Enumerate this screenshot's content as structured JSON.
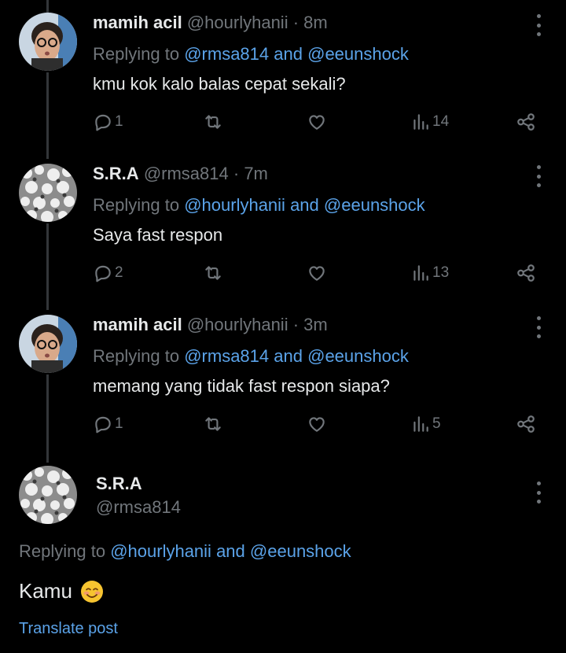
{
  "replies": [
    {
      "name": "mamih acil",
      "handle": "@hourlyhanii",
      "time": "· 8m",
      "replying_prefix": "Replying to",
      "mention1": "@rmsa814",
      "conj": "and",
      "mention2": "@eeunshock",
      "text": "kmu kok kalo balas cepat sekali?",
      "comments": "1",
      "views": "14",
      "avatar": "photo-woman-glasses"
    },
    {
      "name": "S.R.A",
      "handle": "@rmsa814",
      "time": "· 7m",
      "replying_prefix": "Replying to",
      "mention1": "@hourlyhanii",
      "conj": "and",
      "mention2": "@eeunshock",
      "text": "Saya fast respon",
      "comments": "2",
      "views": "13",
      "avatar": "photo-white-blossoms"
    },
    {
      "name": "mamih acil",
      "handle": "@hourlyhanii",
      "time": "· 3m",
      "replying_prefix": "Replying to",
      "mention1": "@rmsa814",
      "conj": "and",
      "mention2": "@eeunshock",
      "text": "memang yang tidak fast respon siapa?",
      "comments": "1",
      "views": "5",
      "avatar": "photo-woman-glasses"
    }
  ],
  "main_post": {
    "name": "S.R.A",
    "handle": "@rmsa814",
    "replying_prefix": "Replying to",
    "mention1": "@hourlyhanii",
    "conj": "and",
    "mention2": "@eeunshock",
    "text": "Kamu",
    "emoji": "smiling-face-emoji",
    "translate": "Translate post",
    "avatar": "photo-white-blossoms"
  },
  "colors": {
    "background": "#000000",
    "text": "#e7e9ea",
    "muted": "#71767b",
    "link": "#5ba3e9",
    "thread_line": "#333639"
  }
}
